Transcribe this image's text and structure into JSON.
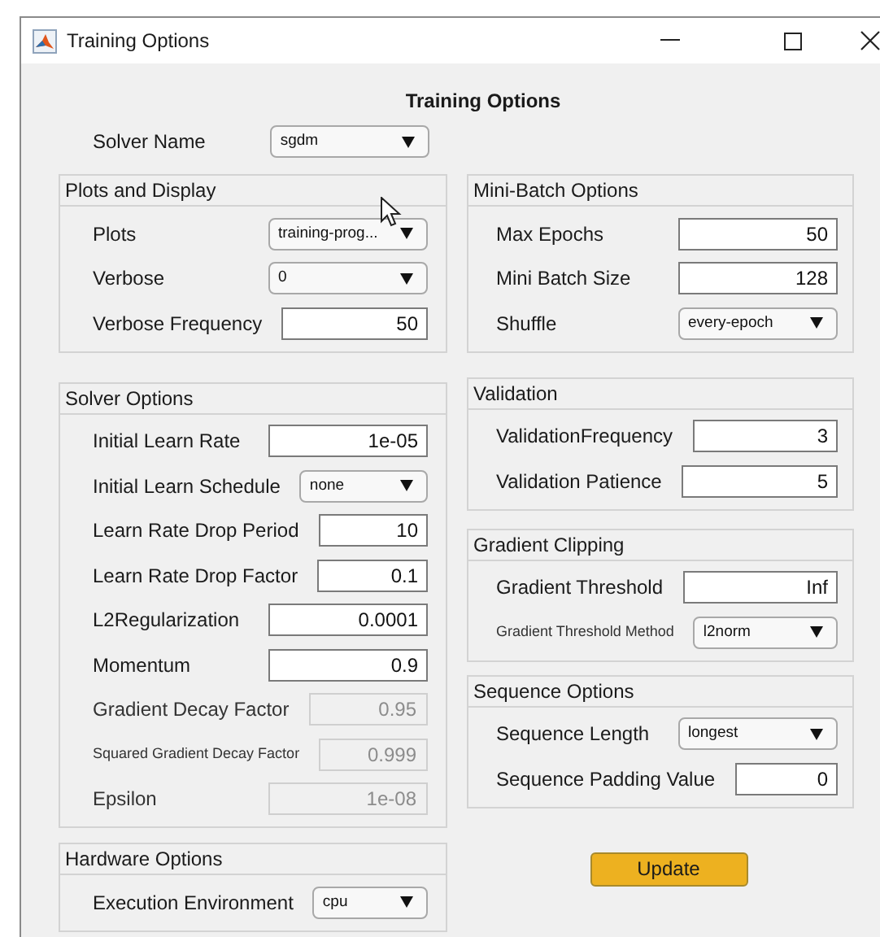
{
  "window": {
    "title": "Training Options"
  },
  "heading": "Training Options",
  "solver": {
    "label": "Solver Name",
    "value": "sgdm",
    "kind": "dropdown",
    "disabled": false
  },
  "left_panels": [
    {
      "title": "Plots and Display",
      "fields": [
        {
          "label": "Plots",
          "value": "training-prog...",
          "kind": "dropdown",
          "disabled": false
        },
        {
          "label": "Verbose",
          "value": "0",
          "kind": "dropdown",
          "disabled": false
        },
        {
          "label": "Verbose Frequency",
          "value": "50",
          "kind": "number",
          "disabled": false
        }
      ]
    },
    {
      "title": "Solver Options",
      "fields": [
        {
          "label": "Initial Learn Rate",
          "value": "1e-05",
          "kind": "number",
          "disabled": false
        },
        {
          "label": "Initial Learn Schedule",
          "value": "none",
          "kind": "dropdown",
          "disabled": false
        },
        {
          "label": "Learn Rate Drop Period",
          "value": "10",
          "kind": "number",
          "disabled": false
        },
        {
          "label": "Learn Rate Drop Factor",
          "value": "0.1",
          "kind": "number",
          "disabled": false
        },
        {
          "label": "L2Regularization",
          "value": "0.0001",
          "kind": "number",
          "disabled": false
        },
        {
          "label": "Momentum",
          "value": "0.9",
          "kind": "number",
          "disabled": false
        },
        {
          "label": "Gradient Decay Factor",
          "value": "0.95",
          "kind": "number",
          "disabled": true
        },
        {
          "label": "Squared Gradient Decay Factor",
          "value": "0.999",
          "kind": "number",
          "disabled": true
        },
        {
          "label": "Epsilon",
          "value": "1e-08",
          "kind": "number",
          "disabled": true
        }
      ]
    },
    {
      "title": "Hardware Options",
      "fields": [
        {
          "label": "Execution Environment",
          "value": "cpu",
          "kind": "dropdown",
          "disabled": false
        }
      ]
    }
  ],
  "right_panels": [
    {
      "title": "Mini-Batch Options",
      "fields": [
        {
          "label": "Max Epochs",
          "value": "50",
          "kind": "number",
          "disabled": false
        },
        {
          "label": "Mini Batch Size",
          "value": "128",
          "kind": "number",
          "disabled": false
        },
        {
          "label": "Shuffle",
          "value": "every-epoch",
          "kind": "dropdown",
          "disabled": false
        }
      ]
    },
    {
      "title": "Validation",
      "fields": [
        {
          "label": "ValidationFrequency",
          "value": "3",
          "kind": "number",
          "disabled": false
        },
        {
          "label": "Validation Patience",
          "value": "5",
          "kind": "number",
          "disabled": false
        }
      ]
    },
    {
      "title": "Gradient Clipping",
      "fields": [
        {
          "label": "Gradient Threshold",
          "value": "Inf",
          "kind": "number",
          "disabled": false
        },
        {
          "label": "Gradient Threshold Method",
          "value": "l2norm",
          "kind": "dropdown",
          "disabled": false
        }
      ]
    },
    {
      "title": "Sequence Options",
      "fields": [
        {
          "label": "Sequence Length",
          "value": "longest",
          "kind": "dropdown",
          "disabled": false
        },
        {
          "label": "Sequence Padding Value",
          "value": "0",
          "kind": "number",
          "disabled": false
        }
      ]
    }
  ],
  "update_button": "Update"
}
